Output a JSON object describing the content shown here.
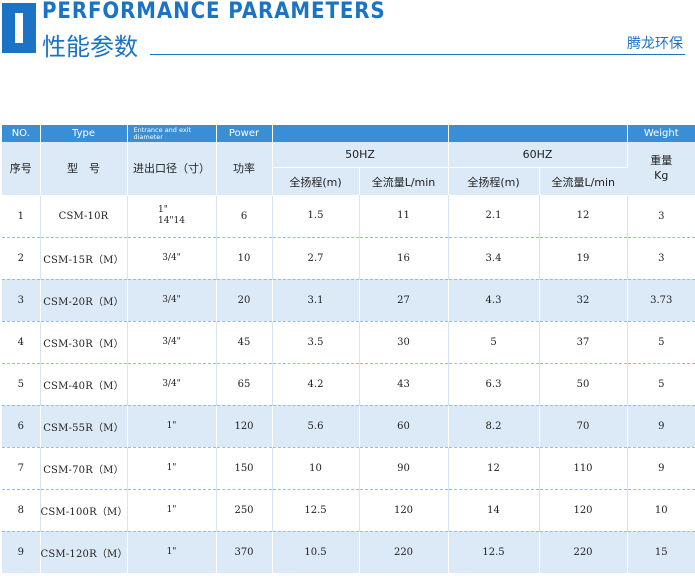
{
  "header": {
    "title_en": "PERFORMANCE PARAMETERS",
    "title_zh": "性能参数",
    "brand": "腾龙环保"
  },
  "table": {
    "en_headers": {
      "no": "NO.",
      "type": "Type",
      "diameter": "Entrance and exit diameter",
      "power": "Power",
      "weight": "Weight"
    },
    "zh_headers": {
      "no": "序号",
      "type": "型　号",
      "diameter": "进出口径（寸）",
      "power": "功率",
      "weight": "重量\nKg"
    },
    "freq": {
      "f50": "50HZ",
      "f60": "60HZ"
    },
    "sub": {
      "lift": "全扬程(m)",
      "flow": "全流量L/min"
    },
    "rows": [
      {
        "no": "1",
        "type": "CSM-10R",
        "diameter": "1\"\n14\"14",
        "power": "6",
        "lift50": "1.5",
        "flow50": "11",
        "lift60": "2.1",
        "flow60": "12",
        "weight": "3"
      },
      {
        "no": "2",
        "type": "CSM-15R（M）",
        "diameter": "3/4\"",
        "power": "10",
        "lift50": "2.7",
        "flow50": "16",
        "lift60": "3.4",
        "flow60": "19",
        "weight": "3"
      },
      {
        "no": "3",
        "type": "CSM-20R（M）",
        "diameter": "3/4\"",
        "power": "20",
        "lift50": "3.1",
        "flow50": "27",
        "lift60": "4.3",
        "flow60": "32",
        "weight": "3.73"
      },
      {
        "no": "4",
        "type": "CSM-30R（M）",
        "diameter": "3/4\"",
        "power": "45",
        "lift50": "3.5",
        "flow50": "30",
        "lift60": "5",
        "flow60": "37",
        "weight": "5"
      },
      {
        "no": "5",
        "type": "CSM-40R（M）",
        "diameter": "3/4\"",
        "power": "65",
        "lift50": "4.2",
        "flow50": "43",
        "lift60": "6.3",
        "flow60": "50",
        "weight": "5"
      },
      {
        "no": "6",
        "type": "CSM-55R（M）",
        "diameter": "1\"",
        "power": "120",
        "lift50": "5.6",
        "flow50": "60",
        "lift60": "8.2",
        "flow60": "70",
        "weight": "9"
      },
      {
        "no": "7",
        "type": "CSM-70R（M）",
        "diameter": "1\"",
        "power": "150",
        "lift50": "10",
        "flow50": "90",
        "lift60": "12",
        "flow60": "110",
        "weight": "9"
      },
      {
        "no": "8",
        "type": "CSM-100R（M）",
        "diameter": "1\"",
        "power": "250",
        "lift50": "12.5",
        "flow50": "120",
        "lift60": "14",
        "flow60": "120",
        "weight": "10"
      },
      {
        "no": "9",
        "type": "CSM-120R（M）",
        "diameter": "1\"",
        "power": "370",
        "lift50": "10.5",
        "flow50": "220",
        "lift60": "12.5",
        "flow60": "220",
        "weight": "15"
      }
    ],
    "highlight_color": "#dce9f6",
    "header_color": "#3a8ed6"
  }
}
